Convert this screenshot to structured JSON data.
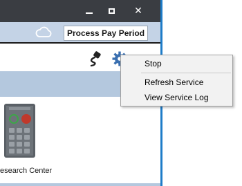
{
  "window": {
    "controls": {
      "minimize": "minimize",
      "maximize": "maximize",
      "close": "✕"
    }
  },
  "toolbar": {
    "cloud_icon": "cloud-icon",
    "process_button_label": "Process Pay Period"
  },
  "icons": {
    "plug": "plug-icon",
    "gear": "gear-icon"
  },
  "tiles": [
    {
      "label": "esearch Center"
    }
  ],
  "context_menu": {
    "items": [
      {
        "label": "Stop"
      },
      {
        "label": "Refresh Service"
      },
      {
        "label": "View Service Log"
      }
    ]
  },
  "colors": {
    "titlebar": "#3a3d42",
    "toolbar": "#c4d3e6",
    "section_band": "#b4c8de",
    "frame_accent": "#1e7cc8",
    "gear": "#3a6fb0",
    "menu_bg": "#f2f2f2"
  }
}
